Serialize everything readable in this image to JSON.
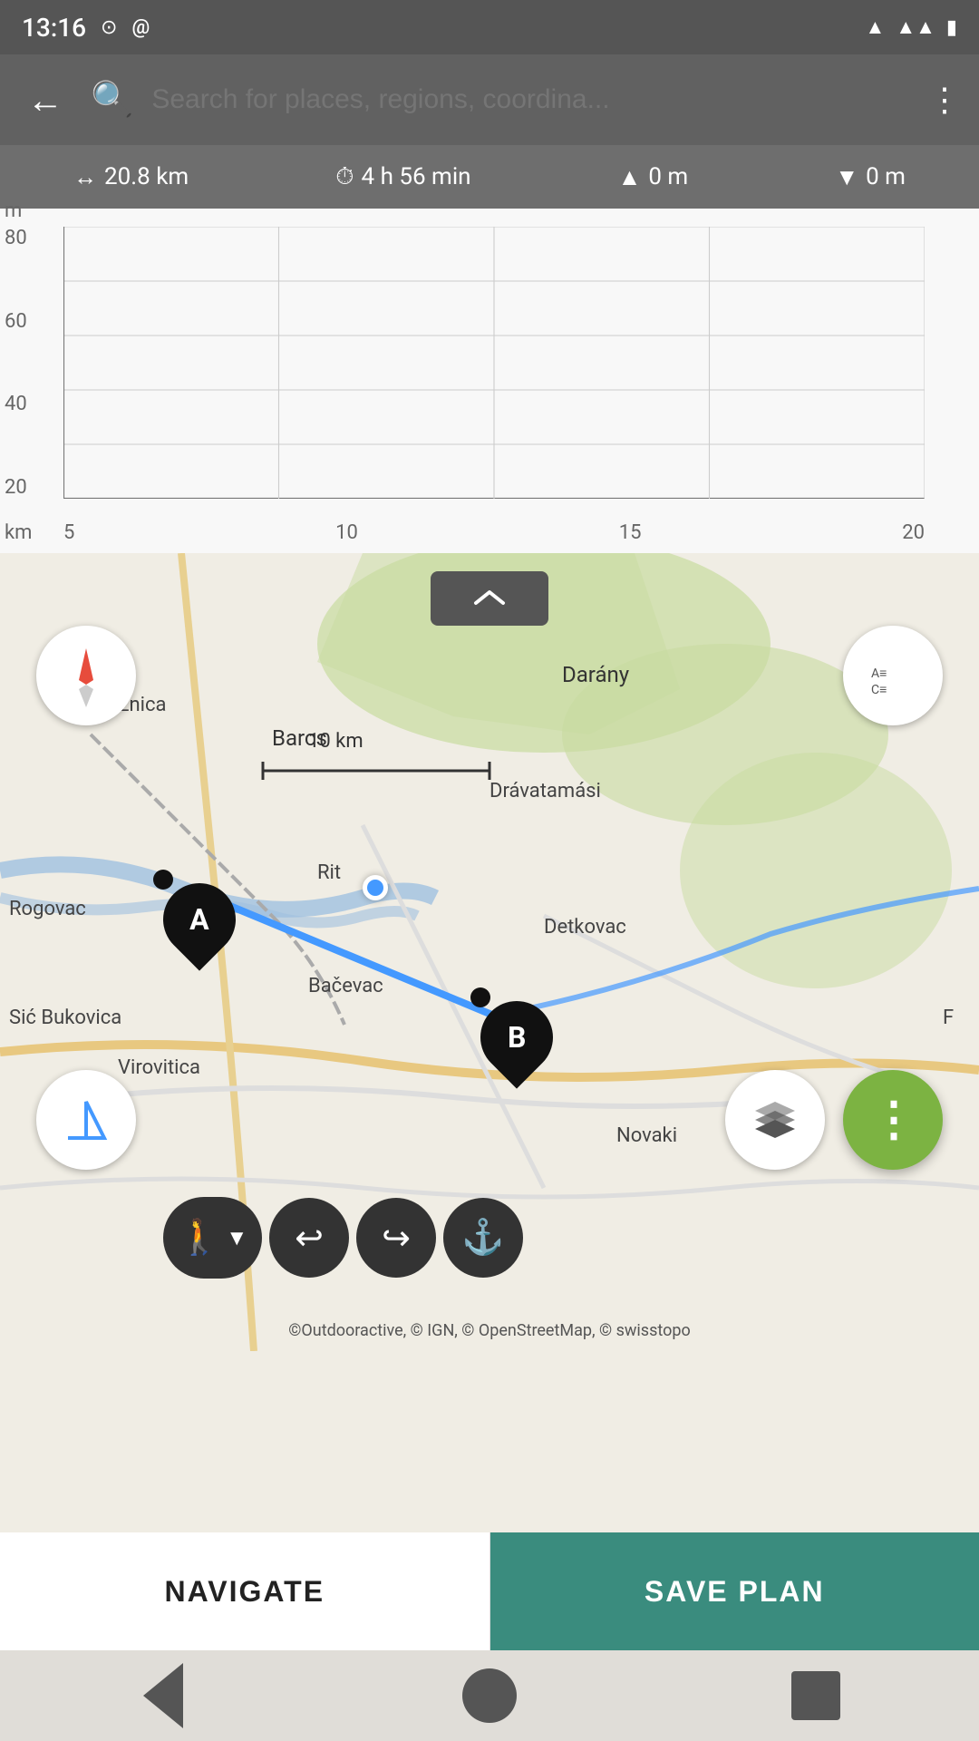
{
  "statusBar": {
    "time": "13:16",
    "icons": [
      "record",
      "at-sign",
      "wifi",
      "signal",
      "battery"
    ]
  },
  "searchBar": {
    "placeholder": "Search for places, regions, coordina...",
    "backLabel": "←",
    "moreLabel": "⋮"
  },
  "stats": {
    "distance": "20.8 km",
    "duration": "4 h 56 min",
    "ascent": "0 m",
    "descent": "0 m"
  },
  "elevationChart": {
    "yUnit": "m",
    "yLabels": [
      "20",
      "40",
      "60",
      "80"
    ],
    "xUnit": "km",
    "xLabels": [
      "5",
      "10",
      "15",
      "20"
    ]
  },
  "map": {
    "scaleLine": "10 km",
    "places": [
      "Križnica",
      "Barcs",
      "Darány",
      "Drávatamási",
      "Rogovac",
      "Rit",
      "Detkovac",
      "Bačevac",
      "Sić Bukovica",
      "Virovitica",
      "Novaki"
    ],
    "copyright": "©Outdooractive, © IGN, © OpenStreetMap, © swisstopo",
    "waypointA": "A",
    "waypointB": "B"
  },
  "toolbar": {
    "walkLabel": "🚶",
    "undoLabel": "↩",
    "redoLabel": "↪",
    "anchorLabel": "⚓"
  },
  "bottomActions": {
    "navigateLabel": "NAVIGATE",
    "savePlanLabel": "SAVE PLAN"
  },
  "navBar": {
    "backLabel": "◀",
    "homeLabel": "●",
    "recentLabel": "■"
  }
}
